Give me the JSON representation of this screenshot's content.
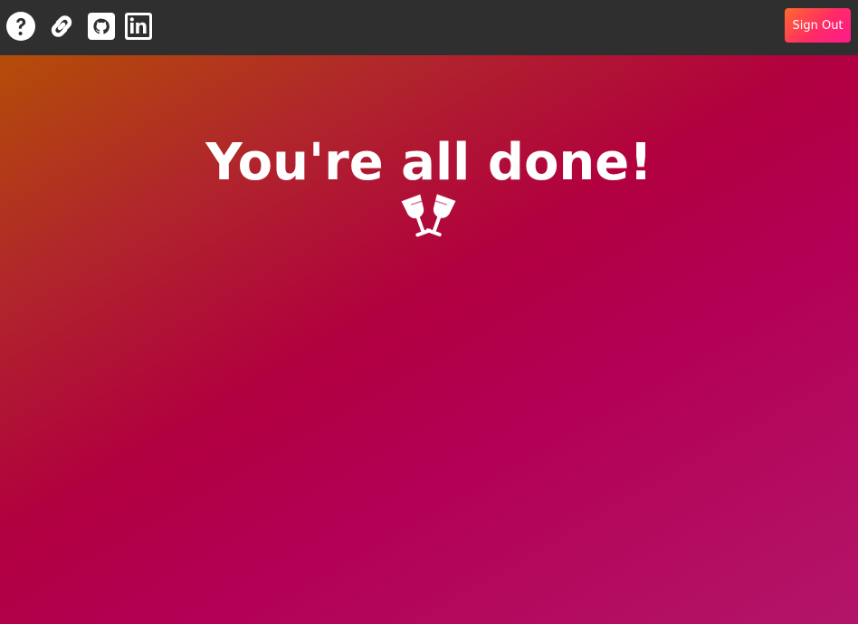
{
  "topbar": {
    "icons": [
      "question-circle-icon",
      "link-icon",
      "github-icon",
      "linkedin-icon"
    ],
    "signout_label": "Sign Out"
  },
  "main": {
    "headline": "You're all done!",
    "celebration_icon": "glasses-cheers-icon"
  },
  "colors": {
    "topbar": "#2f2f2f",
    "text": "#ffffff",
    "gradient_start": "#b44d08",
    "gradient_mid": "#b1003f",
    "gradient_end": "#b31569",
    "button_start": "#ff6a2b",
    "button_end": "#ff1a8c"
  }
}
